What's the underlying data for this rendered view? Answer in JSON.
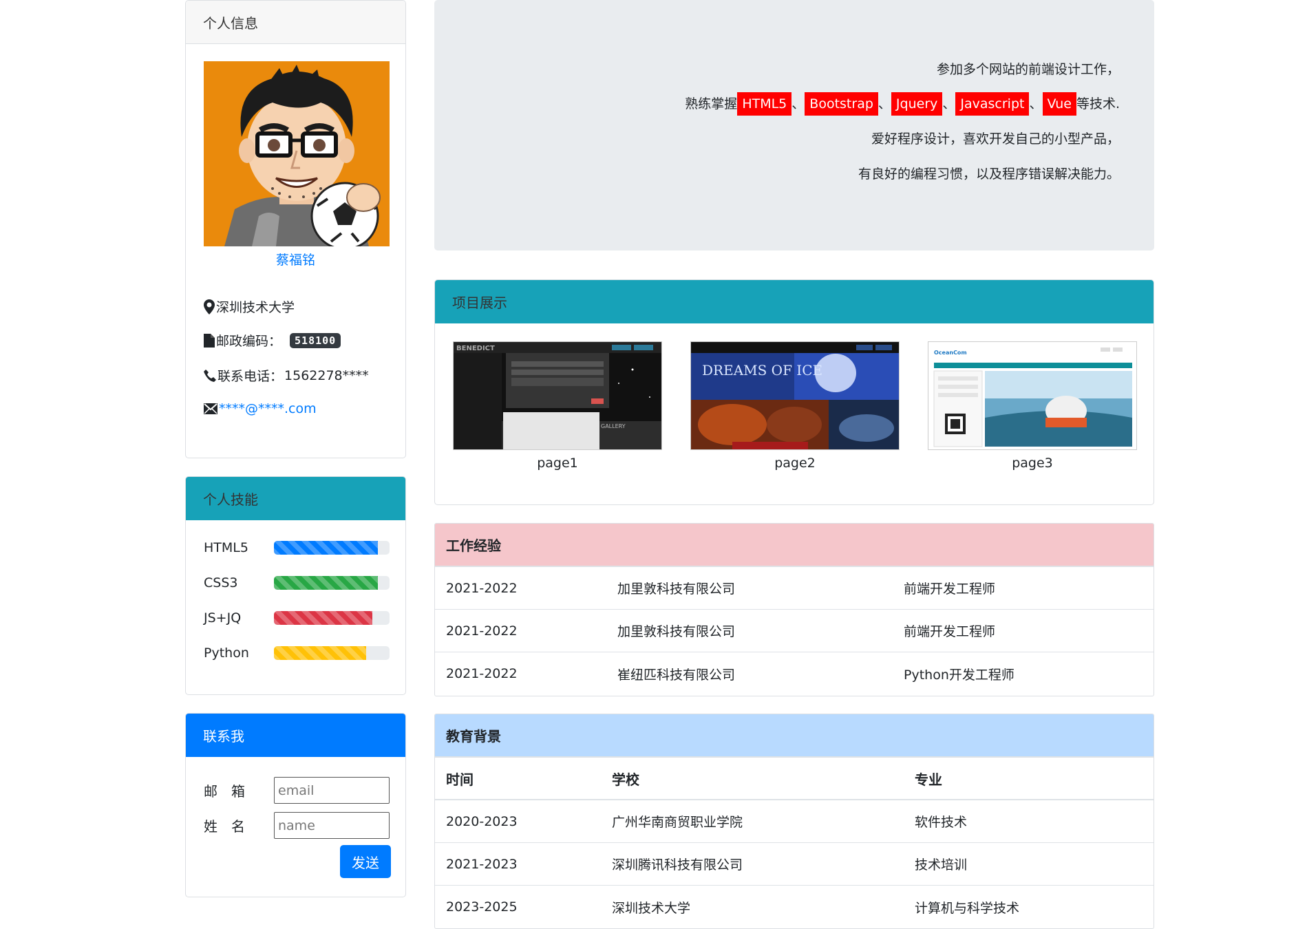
{
  "profile": {
    "header": "个人信息",
    "name": "蔡福铭",
    "school": "深圳技术大学",
    "postcode_label": "邮政编码：",
    "postcode": "518100",
    "phone_label": "联系电话：",
    "phone": "1562278****",
    "email": "****@****.com"
  },
  "skills": {
    "header": "个人技能",
    "items": [
      {
        "name": "HTML5",
        "level": 90,
        "color": "#007bff"
      },
      {
        "name": "CSS3",
        "level": 90,
        "color": "#28a745"
      },
      {
        "name": "JS+JQ",
        "level": 85,
        "color": "#dc3545"
      },
      {
        "name": "Python",
        "level": 80,
        "color": "#ffc107"
      }
    ]
  },
  "contact": {
    "header": "联系我",
    "email_label": "邮箱",
    "email_placeholder": "email",
    "name_label": "姓名",
    "name_placeholder": "name",
    "send": "发送"
  },
  "intro": {
    "line1": "参加多个网站的前端设计工作，",
    "line2_prefix": "熟练掌握",
    "techs": [
      "HTML5",
      "Bootstrap",
      "Jquery",
      "Javascript",
      "Vue"
    ],
    "sep": "、",
    "line2_suffix": "等技术.",
    "line3": "爱好程序设计，喜欢开发自己的小型产品，",
    "line4": "有良好的编程习惯，以及程序错误解决能力。"
  },
  "projects": {
    "header": "项目展示",
    "items": [
      {
        "caption": "page1",
        "title": "BENEDICT",
        "gallery": "GALLERY"
      },
      {
        "caption": "page2",
        "title": "DREAMS OF ICE"
      },
      {
        "caption": "page3",
        "title": "OceanCom"
      }
    ]
  },
  "work": {
    "title": "工作经验",
    "rows": [
      [
        "2021-2022",
        "加里敦科技有限公司",
        "前端开发工程师"
      ],
      [
        "2021-2022",
        "加里敦科技有限公司",
        "前端开发工程师"
      ],
      [
        "2021-2022",
        "崔纽匹科技有限公司",
        "Python开发工程师"
      ]
    ]
  },
  "education": {
    "title": "教育背景",
    "headers": [
      "时间",
      "学校",
      "专业"
    ],
    "rows": [
      [
        "2020-2023",
        "广州华南商贸职业学院",
        "软件技术"
      ],
      [
        "2021-2023",
        "深圳腾讯科技有限公司",
        "技术培训"
      ],
      [
        "2023-2025",
        "深圳技术大学",
        "计算机与科学技术"
      ]
    ]
  }
}
